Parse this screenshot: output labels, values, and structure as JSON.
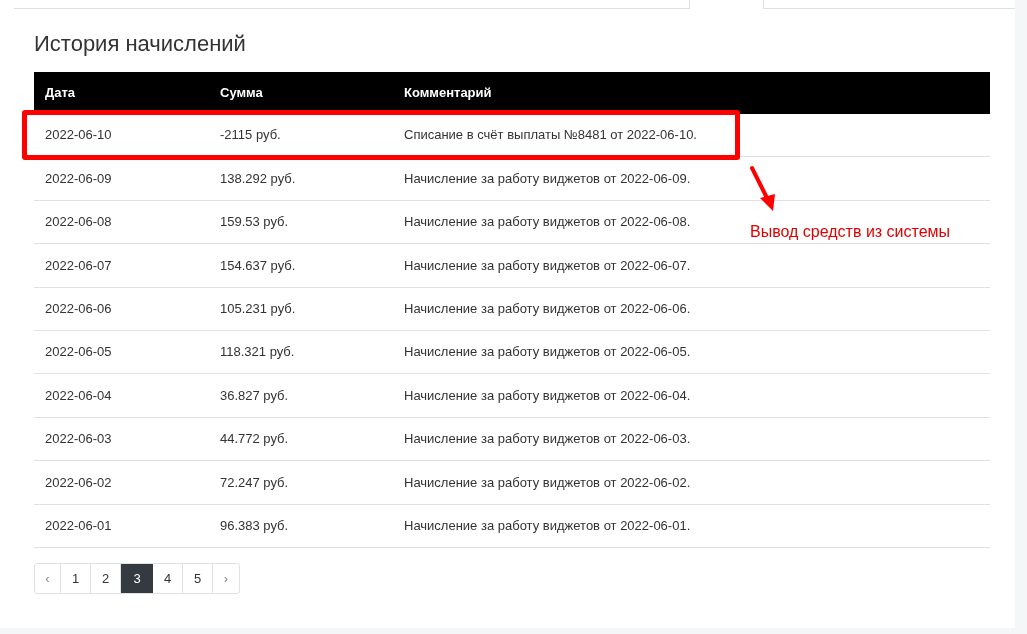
{
  "title": "История начислений",
  "table": {
    "columns": [
      "Дата",
      "Сумма",
      "Комментарий"
    ],
    "rows": [
      {
        "date": "2022-06-10",
        "amount": "-2115 руб.",
        "comment": "Списание в счёт выплаты №8481 от 2022-06-10.",
        "highlighted": true
      },
      {
        "date": "2022-06-09",
        "amount": "138.292 руб.",
        "comment": "Начисление за работу виджетов от 2022-06-09.",
        "highlighted": false
      },
      {
        "date": "2022-06-08",
        "amount": "159.53 руб.",
        "comment": "Начисление за работу виджетов от 2022-06-08.",
        "highlighted": false
      },
      {
        "date": "2022-06-07",
        "amount": "154.637 руб.",
        "comment": "Начисление за работу виджетов от 2022-06-07.",
        "highlighted": false
      },
      {
        "date": "2022-06-06",
        "amount": "105.231 руб.",
        "comment": "Начисление за работу виджетов от 2022-06-06.",
        "highlighted": false
      },
      {
        "date": "2022-06-05",
        "amount": "118.321 руб.",
        "comment": "Начисление за работу виджетов от 2022-06-05.",
        "highlighted": false
      },
      {
        "date": "2022-06-04",
        "amount": "36.827 руб.",
        "comment": "Начисление за работу виджетов от 2022-06-04.",
        "highlighted": false
      },
      {
        "date": "2022-06-03",
        "amount": "44.772 руб.",
        "comment": "Начисление за работу виджетов от 2022-06-03.",
        "highlighted": false
      },
      {
        "date": "2022-06-02",
        "amount": "72.247 руб.",
        "comment": "Начисление за работу виджетов от 2022-06-02.",
        "highlighted": false
      },
      {
        "date": "2022-06-01",
        "amount": "96.383 руб.",
        "comment": "Начисление за работу виджетов от 2022-06-01.",
        "highlighted": false
      }
    ]
  },
  "annotation": {
    "label": "Вывод средств из системы"
  },
  "pagination": {
    "prev": "‹",
    "next": "›",
    "pages": [
      {
        "label": "1",
        "selected": false
      },
      {
        "label": "2",
        "selected": false
      },
      {
        "label": "3",
        "selected": true
      },
      {
        "label": "4",
        "selected": false
      },
      {
        "label": "5",
        "selected": false
      }
    ]
  }
}
